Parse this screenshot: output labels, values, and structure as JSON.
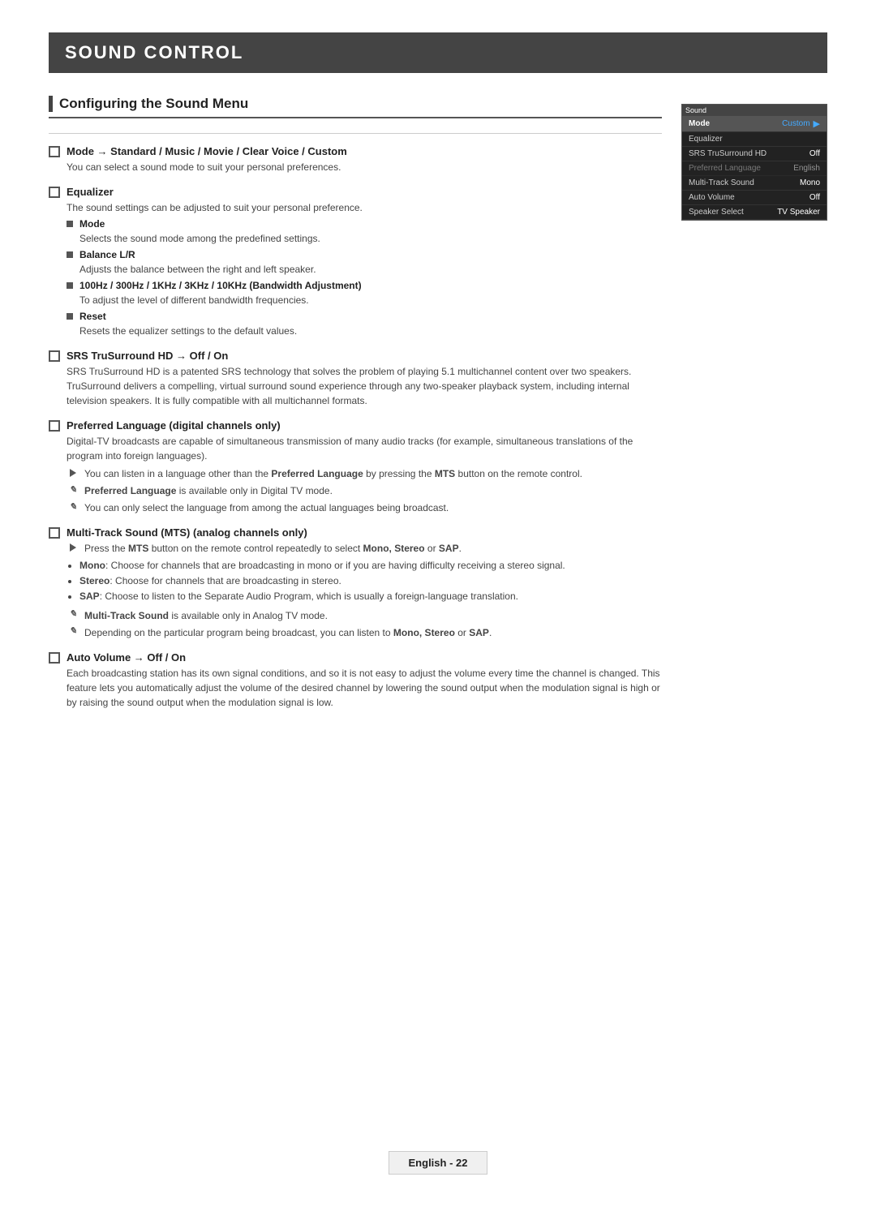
{
  "page": {
    "title": "SOUND CONTROL",
    "section_title": "Configuring the Sound Menu",
    "footer_label": "English - 22"
  },
  "menu_panel": {
    "top_bar": "Sound",
    "rows": [
      {
        "label": "Mode",
        "value": "Custom",
        "active": true,
        "has_arrow": true
      },
      {
        "label": "Equalizer",
        "value": "",
        "active": false
      },
      {
        "label": "SRS TruSurround HD",
        "value": "Off",
        "active": false
      },
      {
        "label": "Preferred Language",
        "value": "English",
        "active": false,
        "dimmed": true
      },
      {
        "label": "Multi-Track Sound",
        "value": "Mono",
        "active": false
      },
      {
        "label": "Auto Volume",
        "value": "Off",
        "active": false
      },
      {
        "label": "Speaker Select",
        "value": "TV Speaker",
        "active": false
      }
    ]
  },
  "items": [
    {
      "id": "mode",
      "heading": "Mode → Standard / Music / Movie / Clear Voice / Custom",
      "desc": "You can select a sound mode to suit your personal preferences.",
      "sub_items": []
    },
    {
      "id": "equalizer",
      "heading": "Equalizer",
      "desc": "The sound settings can be adjusted to suit your personal preference.",
      "sub_items": [
        {
          "label": "Mode",
          "desc": "Selects the sound mode among the predefined settings."
        },
        {
          "label": "Balance L/R",
          "desc": "Adjusts the balance between the right and left speaker."
        },
        {
          "label": "100Hz / 300Hz / 1KHz / 3KHz / 10KHz (Bandwidth Adjustment)",
          "desc": "To adjust the level of different bandwidth frequencies."
        },
        {
          "label": "Reset",
          "desc": "Resets the equalizer settings to the default values."
        }
      ]
    },
    {
      "id": "srs",
      "heading": "SRS TruSurround HD → Off / On",
      "desc": "SRS TruSurround HD is a patented SRS technology that solves the problem of playing 5.1 multichannel content over two speakers. TruSurround delivers a compelling, virtual surround sound experience through any two-speaker playback system, including internal television speakers. It is fully compatible with all multichannel formats."
    },
    {
      "id": "preferred-language",
      "heading": "Preferred Language (digital channels only)",
      "desc": "Digital-TV broadcasts are capable of simultaneous transmission of many audio tracks (for example, simultaneous translations of the program into foreign languages).",
      "notes": [
        {
          "type": "play",
          "text": "You can listen in a language other than the Preferred Language by pressing the MTS button on the remote control."
        },
        {
          "type": "memo",
          "text": "Preferred Language is available only in Digital TV mode."
        },
        {
          "type": "memo",
          "text": "You can only select the language from among the actual languages being broadcast."
        }
      ]
    },
    {
      "id": "multi-track",
      "heading": "Multi-Track Sound (MTS) (analog channels only)",
      "bullets": [
        {
          "type": "play",
          "text": "Press the MTS button on the remote control repeatedly to select Mono, Stereo or SAP."
        },
        {
          "type": "dot",
          "text": "Mono: Choose for channels that are broadcasting in mono or if you are having difficulty receiving a stereo signal."
        },
        {
          "type": "dot",
          "text": "Stereo: Choose for channels that are broadcasting in stereo."
        },
        {
          "type": "dot",
          "text": "SAP: Choose to listen to the Separate Audio Program, which is usually a foreign-language translation."
        },
        {
          "type": "memo",
          "text": "Multi-Track Sound is available only in Analog TV mode."
        },
        {
          "type": "memo",
          "text": "Depending on the particular program being broadcast, you can listen to Mono, Stereo or SAP."
        }
      ]
    },
    {
      "id": "auto-volume",
      "heading": "Auto Volume → Off / On",
      "desc": "Each broadcasting station has its own signal conditions, and so it is not easy to adjust the volume every time the channel is changed. This feature lets you automatically adjust the volume of the desired channel by lowering the sound output when the modulation signal is high or by raising the sound output when the modulation signal is low."
    }
  ]
}
